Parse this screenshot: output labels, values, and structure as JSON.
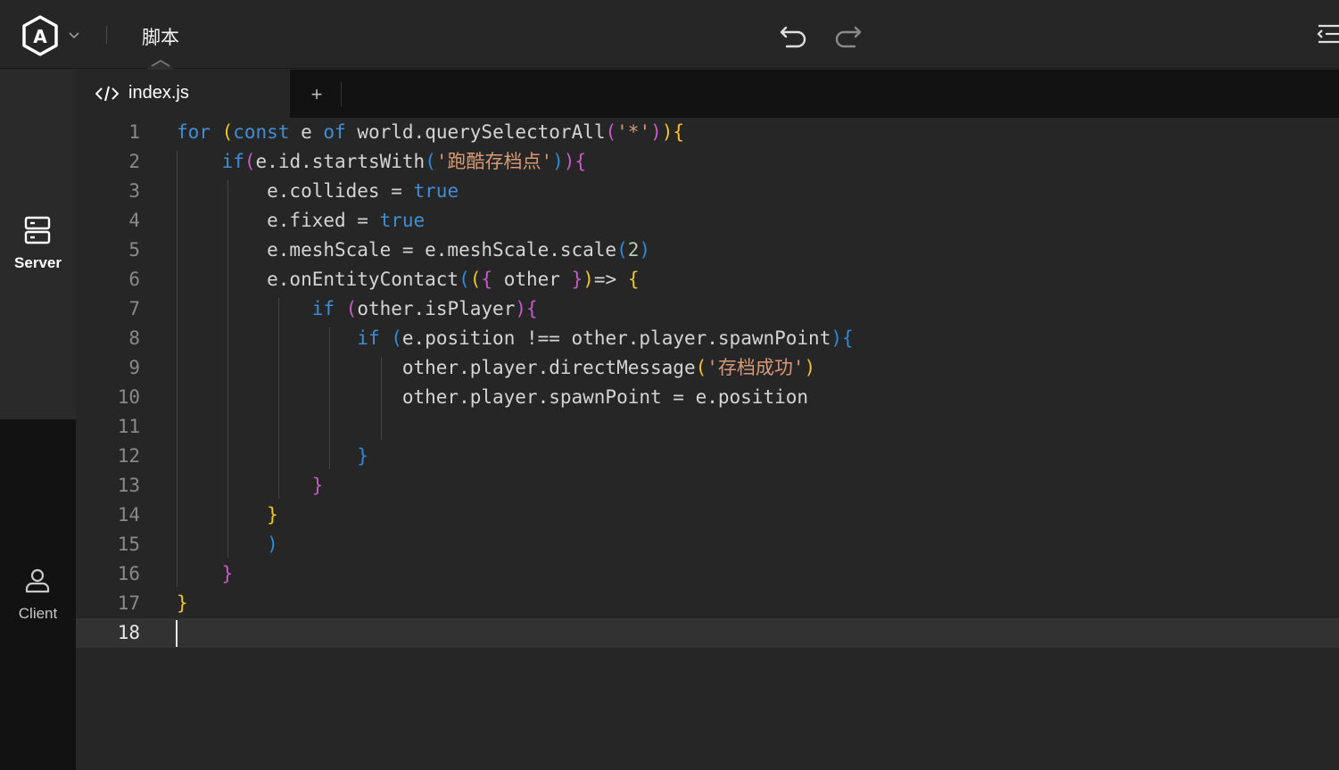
{
  "header": {
    "title": "脚本",
    "logo_letter": "A"
  },
  "sidebar": {
    "server_label": "Server",
    "client_label": "Client"
  },
  "tabs": {
    "active_label": "index.js",
    "add_label": "+"
  },
  "editor": {
    "current_line": 18,
    "lines": [
      [
        [
          "for",
          "kw"
        ],
        [
          " ",
          "pl"
        ],
        [
          "(",
          "b1"
        ],
        [
          "const",
          "kw"
        ],
        [
          " e ",
          "pl"
        ],
        [
          "of",
          "kw"
        ],
        [
          " world.querySelectorAll",
          "pl"
        ],
        [
          "(",
          "b2"
        ],
        [
          "'*'",
          "str"
        ],
        [
          ")",
          "b2"
        ],
        [
          ")",
          "b1"
        ],
        [
          "{",
          "b1"
        ]
      ],
      [
        [
          "    ",
          "pl"
        ],
        [
          "if",
          "kw"
        ],
        [
          "(",
          "b2"
        ],
        [
          "e.id.startsWith",
          "pl"
        ],
        [
          "(",
          "b3"
        ],
        [
          "'跑酷存档点'",
          "str"
        ],
        [
          ")",
          "b3"
        ],
        [
          ")",
          "b2"
        ],
        [
          "{",
          "b2"
        ]
      ],
      [
        [
          "        e.collides = ",
          "pl"
        ],
        [
          "true",
          "kw"
        ]
      ],
      [
        [
          "        e.fixed = ",
          "pl"
        ],
        [
          "true",
          "kw"
        ]
      ],
      [
        [
          "        e.meshScale = e.meshScale.scale",
          "pl"
        ],
        [
          "(",
          "b3"
        ],
        [
          "2",
          "num"
        ],
        [
          ")",
          "b3"
        ]
      ],
      [
        [
          "        e.onEntityContact",
          "pl"
        ],
        [
          "(",
          "b3"
        ],
        [
          "(",
          "b1"
        ],
        [
          "{",
          "b2"
        ],
        [
          " other ",
          "pl"
        ],
        [
          "}",
          "b2"
        ],
        [
          ")",
          "b1"
        ],
        [
          "=> ",
          "pl"
        ],
        [
          "{",
          "b1"
        ]
      ],
      [
        [
          "            ",
          "pl"
        ],
        [
          "if",
          "kw"
        ],
        [
          " ",
          "pl"
        ],
        [
          "(",
          "b2"
        ],
        [
          "other.isPlayer",
          "pl"
        ],
        [
          ")",
          "b2"
        ],
        [
          "{",
          "b2"
        ]
      ],
      [
        [
          "                ",
          "pl"
        ],
        [
          "if",
          "kw"
        ],
        [
          " ",
          "pl"
        ],
        [
          "(",
          "b3"
        ],
        [
          "e.position !== other.player.spawnPoint",
          "pl"
        ],
        [
          ")",
          "b3"
        ],
        [
          "{",
          "b3"
        ]
      ],
      [
        [
          "                    other.player.directMessage",
          "pl"
        ],
        [
          "(",
          "b1"
        ],
        [
          "'存档成功'",
          "str"
        ],
        [
          ")",
          "b1"
        ]
      ],
      [
        [
          "                    other.player.spawnPoint = e.position",
          "pl"
        ]
      ],
      [
        [
          "",
          "pl"
        ]
      ],
      [
        [
          "                ",
          "pl"
        ],
        [
          "}",
          "b3"
        ]
      ],
      [
        [
          "            ",
          "pl"
        ],
        [
          "}",
          "b2"
        ]
      ],
      [
        [
          "        ",
          "pl"
        ],
        [
          "}",
          "b1"
        ]
      ],
      [
        [
          "        ",
          "pl"
        ],
        [
          ")",
          "b3"
        ]
      ],
      [
        [
          "    ",
          "pl"
        ],
        [
          "}",
          "b2"
        ]
      ],
      [
        [
          "}",
          "b1"
        ]
      ],
      [
        [
          "",
          "pl"
        ]
      ]
    ]
  },
  "colors": {
    "keyword": "#3f8fd6",
    "string": "#d69a75",
    "bracket_gold": "#f2c62a",
    "bracket_magenta": "#c85ac9",
    "bracket_blue": "#2f8bd9",
    "background": "#262626"
  },
  "icons": {
    "logo": "logo-icon",
    "undo": "undo-icon",
    "redo": "redo-icon",
    "panel": "panel-toggle-icon",
    "server": "server-icon",
    "client": "user-icon",
    "file": "code-icon"
  }
}
